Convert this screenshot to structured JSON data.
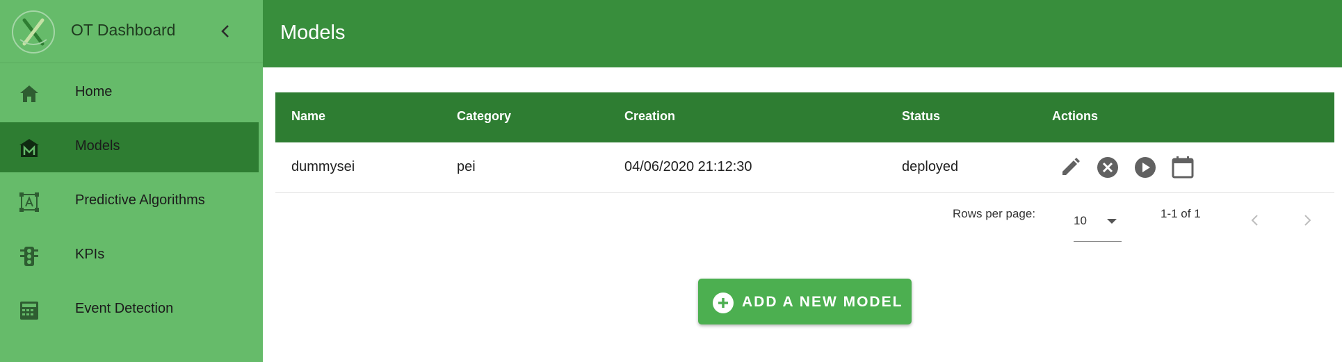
{
  "app": {
    "title": "OT Dashboard"
  },
  "sidebar": {
    "items": [
      {
        "label": "Home",
        "icon": "home-icon"
      },
      {
        "label": "Models",
        "icon": "models-icon",
        "active": true
      },
      {
        "label": "Predictive Algorithms",
        "icon": "algorithm-icon"
      },
      {
        "label": "KPIs",
        "icon": "traffic-light-icon"
      },
      {
        "label": "Event Detection",
        "icon": "event-detection-icon"
      }
    ]
  },
  "header": {
    "title": "Models"
  },
  "table": {
    "columns": [
      "Name",
      "Category",
      "Creation",
      "Status",
      "Actions"
    ],
    "rows": [
      {
        "name": "dummysei",
        "category": "pei",
        "creation": "04/06/2020 21:12:30",
        "status": "deployed"
      }
    ]
  },
  "pagination": {
    "rows_per_page_label": "Rows per page:",
    "rows_per_page_value": "10",
    "range_text": "1-1 of 1"
  },
  "actions": {
    "add_label": "ADD A NEW MODEL"
  },
  "colors": {
    "sidebar_bg": "#66bb6a",
    "sidebar_active": "#2e7d32",
    "header_bg": "#388e3c",
    "table_header_bg": "#2e7d32",
    "button_bg": "#4caf50"
  }
}
